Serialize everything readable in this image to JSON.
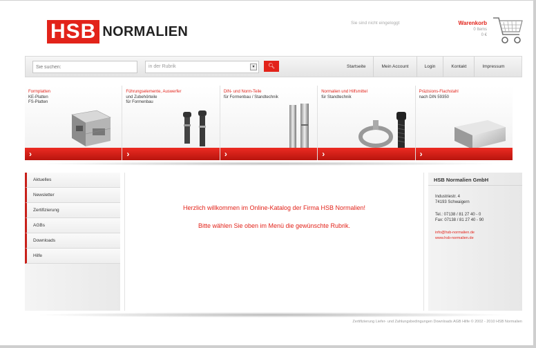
{
  "header": {
    "logo_mark": "HSB",
    "logo_text": "NORMALIEN",
    "login_status": "Sie sind nicht eingeloggt",
    "cart": {
      "title": "Warenkorb",
      "items": "0 Items",
      "total": "0 €"
    }
  },
  "search": {
    "placeholder": "Sie suchen:",
    "rubrik_placeholder": "in der Rubrik",
    "button_icon": "search-icon"
  },
  "nav": [
    "Startseite",
    "Mein Account",
    "Login",
    "Kontakt",
    "Impressum"
  ],
  "categories": [
    {
      "title": "Formplatten",
      "sub": "KE-Platten\nFS-Platten"
    },
    {
      "title": "Führungselemente, Auswerfer",
      "sub": "und Zubehörteile\nfür Formenbau"
    },
    {
      "title": "DIN- und Norm-Teile",
      "sub": "für Formenbau / Standtechnik"
    },
    {
      "title": "Normalien und Hilfsmittel",
      "sub": "für Standtechnik"
    },
    {
      "title": "Präzisions-Flachstahl",
      "sub": "nach DIN 59350"
    }
  ],
  "sidebar": [
    "Aktuelles",
    "Newsletter",
    "Zertifizierung",
    "AGBs",
    "Downloads",
    "Hilfe"
  ],
  "welcome": {
    "line1": "Herzlich willkommen im Online-Katalog der Firma HSB Normalien!",
    "line2": "Bitte wählen Sie oben im Menü die gewünschte Rubrik."
  },
  "company": {
    "name": "HSB Normalien GmbH",
    "street": "Industriestr. 4",
    "city": "74193 Schwaigern",
    "tel": "Tel.: 07138 / 81 27 40 - 0",
    "fax": "Fax: 07138 / 81 27 40 - 90",
    "email": "info@hsb-normalien.de",
    "web": "www.hsb-normalien.de"
  },
  "footer": "Zertifizierung Liefer- und Zahlungsbedingungen Downloads AGB Hilfe © 2002 - 2010 HSB Normalien",
  "colors": {
    "brand_red": "#e2231a"
  }
}
